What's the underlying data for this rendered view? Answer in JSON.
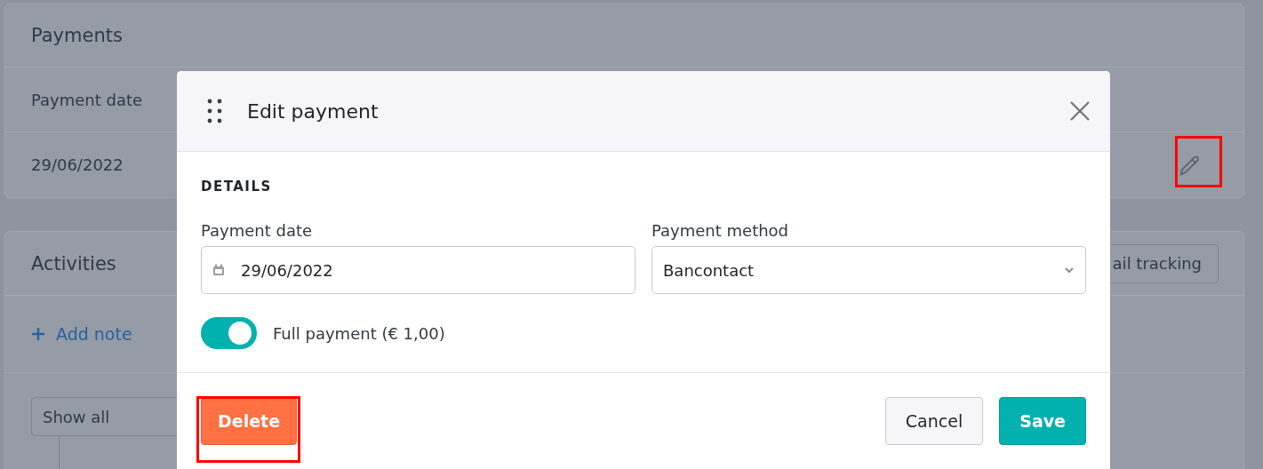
{
  "background": {
    "payments": {
      "title": "Payments",
      "column": "Payment date",
      "rows": [
        {
          "date": "29/06/2022"
        }
      ]
    },
    "activities": {
      "title": "Activities",
      "button": "ail tracking",
      "add_note": "Add note",
      "filter": "Show all"
    }
  },
  "modal": {
    "title": "Edit payment",
    "section": "DETAILS",
    "fields": [
      {
        "label": "Payment date",
        "value": "29/06/2022",
        "kind": "date"
      },
      {
        "label": "Payment method",
        "value": "Bancontact",
        "kind": "select"
      }
    ],
    "toggle": {
      "label": "Full payment (€ 1,00)",
      "on": true
    },
    "buttons": [
      {
        "label": "Delete",
        "kind": "danger"
      },
      {
        "label": "Cancel",
        "kind": "secondary"
      },
      {
        "label": "Save",
        "kind": "primary"
      }
    ]
  }
}
